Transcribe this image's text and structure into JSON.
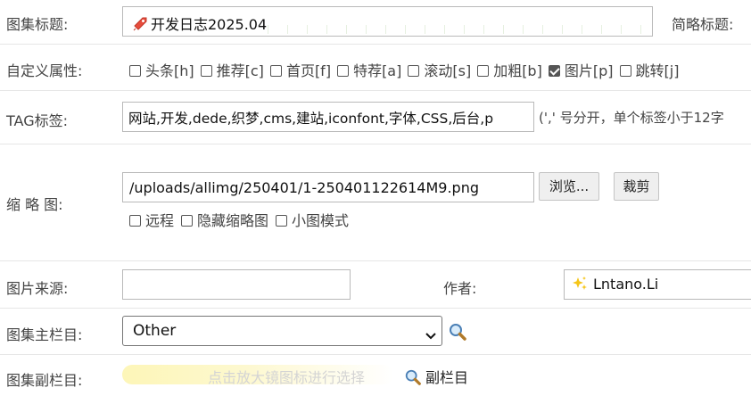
{
  "title_row": {
    "label": "图集标题:",
    "title_icon": "rocket-icon",
    "title_value": "开发日志2025.04",
    "short_title_label": "简略标题:"
  },
  "attributes_row": {
    "label": "自定义属性:",
    "options": [
      {
        "text": "头条[h]",
        "checked": false
      },
      {
        "text": "推荐[c]",
        "checked": false
      },
      {
        "text": "首页[f]",
        "checked": false
      },
      {
        "text": "特荐[a]",
        "checked": false
      },
      {
        "text": "滚动[s]",
        "checked": false
      },
      {
        "text": "加粗[b]",
        "checked": false
      },
      {
        "text": "图片[p]",
        "checked": true
      },
      {
        "text": "跳转[j]",
        "checked": false
      }
    ]
  },
  "tag_row": {
    "label": "TAG标签:",
    "value": "网站,开发,dede,织梦,cms,建站,iconfont,字体,CSS,后台,p",
    "hint": "(',' 号分开，单个标签小于12字"
  },
  "thumb_row": {
    "label": "缩 略 图:",
    "path": "/uploads/allimg/250401/1-250401122614M9.png",
    "browse_label": "浏览...",
    "crop_label": "裁剪",
    "options": [
      {
        "text": "远程",
        "checked": false
      },
      {
        "text": "隐藏缩略图",
        "checked": false
      },
      {
        "text": "小图模式",
        "checked": false
      }
    ]
  },
  "source_row": {
    "label": "图片来源:",
    "source_value": "",
    "author_label": "作者:",
    "author_icon": "sparkles-icon",
    "author_value": "Lntano.Li"
  },
  "main_category_row": {
    "label": "图集主栏目:",
    "selected": "Other",
    "search_icon": "magnifier-icon"
  },
  "sub_category_row": {
    "label": "图集副栏目:",
    "placeholder_hint": "点击放大镜图标进行选择",
    "search_icon": "magnifier-icon",
    "link_label": "副栏目"
  },
  "colors": {
    "highlight": "#fdf6b8",
    "checkbox_checked": "#555555",
    "border": "#b9b9b9"
  }
}
